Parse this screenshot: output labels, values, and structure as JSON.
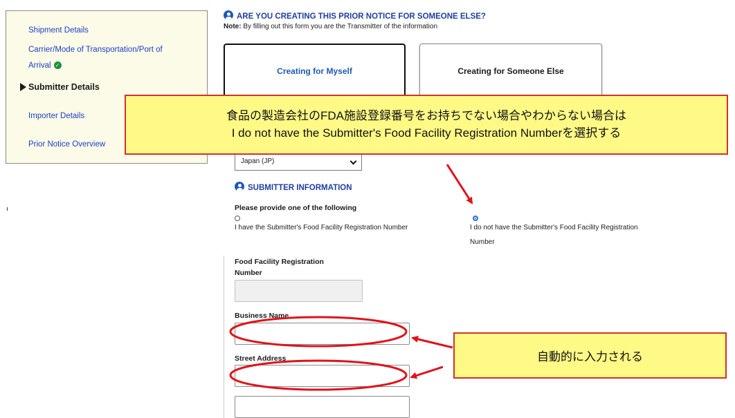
{
  "sidebar": {
    "items": [
      {
        "label": "Shipment Details"
      },
      {
        "label": "Carrier/Mode of Transportation/Port of"
      },
      {
        "label": "Arrival"
      },
      {
        "label": "Submitter Details"
      },
      {
        "label": "Importer Details"
      },
      {
        "label": "Prior Notice Overview"
      }
    ]
  },
  "prior_notice": {
    "heading": "ARE YOU CREATING THIS PRIOR NOTICE FOR SOMEONE ELSE?",
    "note_prefix": "Note:",
    "note_text": "By filling out this form you are the Transmitter of the information",
    "card_myself": "Creating for Myself",
    "card_else": "Creating for Someone Else"
  },
  "callouts": {
    "top_line1": "食品の製造会社のFDA施設登録番号をお持ちでない場合やわからない場合は",
    "top_line2": "I do not have the Submitter's Food Facility Registration Numberを選択する",
    "bottom": "自動的に入力される"
  },
  "country": {
    "selected": "Japan (JP)"
  },
  "submitter": {
    "heading": "SUBMITTER INFORMATION",
    "prompt": "Please provide one of the following",
    "radio_have": "I have the Submitter's Food Facility Registration Number",
    "radio_not_line1": "I do not have the Submitter's Food Facility Registration",
    "radio_not_line2": "Number",
    "radio_selected": "not",
    "ffr_label_line1": "Food Facility Registration",
    "ffr_label_line2": "Number",
    "business_label": "Business Name",
    "street_label": "Street Address"
  },
  "colors": {
    "callout_fill": "#fffa86",
    "callout_border": "#d3312a",
    "link": "#1a3fc4",
    "accent": "#1f59b5",
    "annotation_red": "#e0121a"
  }
}
